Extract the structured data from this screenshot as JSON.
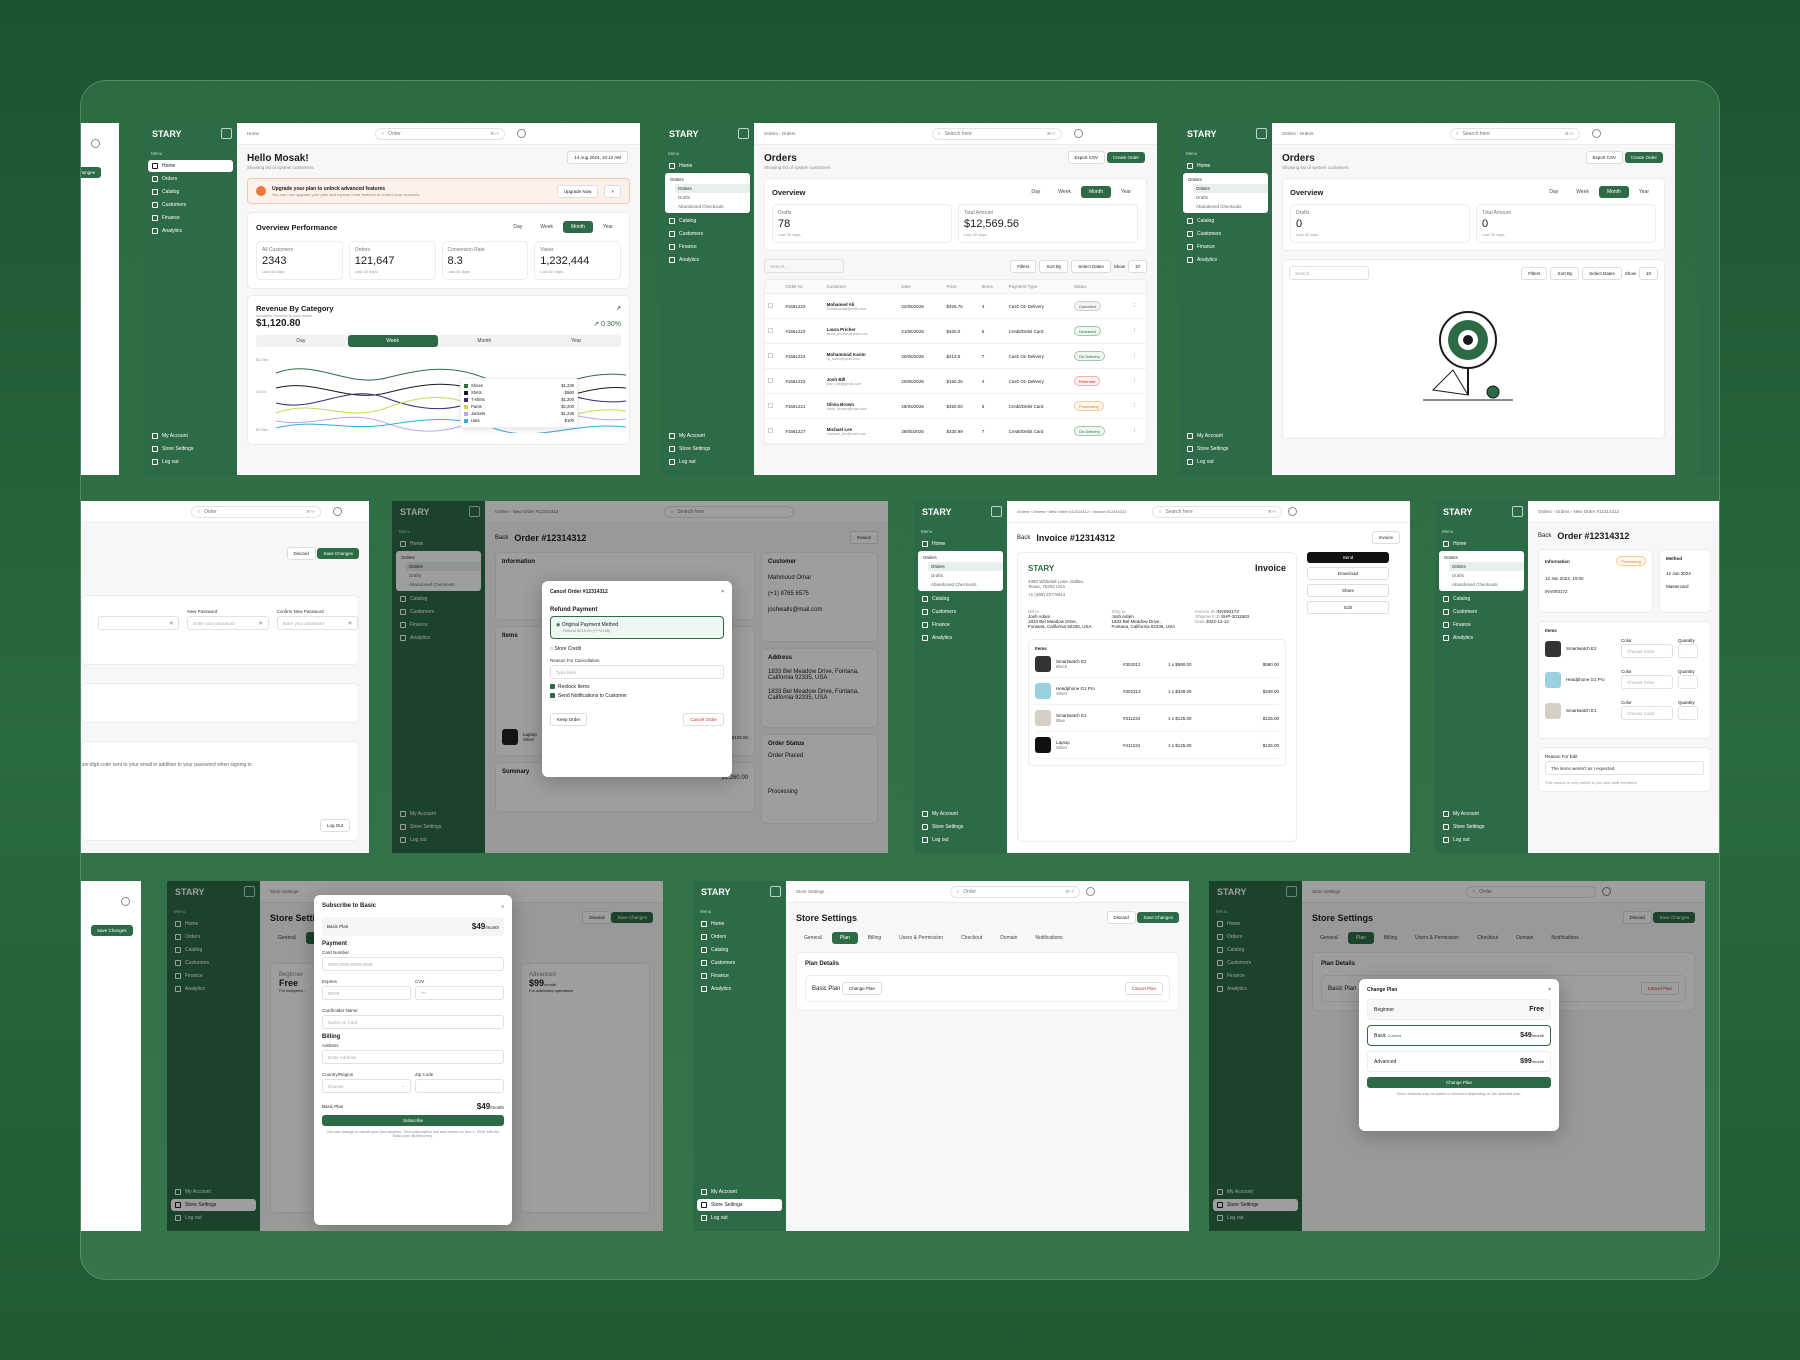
{
  "brand": "STARY",
  "menu_label": "Menu",
  "nav": {
    "home": "Home",
    "orders": "Orders",
    "catalog": "Catalog",
    "customers": "Customers",
    "finance": "Finance",
    "analytics": "Analytics",
    "my_account": "My Account",
    "store_settings": "Store Settings",
    "log_out": "Log out",
    "orders_sub": [
      "Orders",
      "Drafts",
      "Abandoned Checkouts"
    ]
  },
  "dashboard": {
    "breadcrumb": "Home",
    "search": "Order",
    "kbd": "⌘+F",
    "greeting": "Hello Mosak!",
    "subtitle": "Showing list of system customers",
    "date": "14 Aug 2024, 10:12 AM",
    "upgrade_title": "Upgrade your plan to unlock advanced features",
    "upgrade_desc": "You can now upgrade your plan and explore more features to control your accounts",
    "upgrade_btn": "Upgrade Now",
    "overview_title": "Overview Performance",
    "periods": [
      "Day",
      "Week",
      "Month",
      "Year"
    ],
    "stats": [
      {
        "label": "All Customers",
        "value": "2343",
        "sub": "Last 30 days"
      },
      {
        "label": "Orders",
        "value": "121,647",
        "sub": "Last 30 days"
      },
      {
        "label": "Conversion Rate",
        "value": "8.3",
        "sub": "Last 30 days"
      },
      {
        "label": "Views",
        "value": "1,232,444",
        "sub": "Last 30 days"
      }
    ],
    "revenue_title": "Revenue By Category",
    "revenue_sub": "Available revenue in your wallet",
    "revenue_value": "$1,120.80",
    "revenue_change": "↗ 0.30%",
    "y_ticks": [
      "$2.5bn",
      "40 bn",
      "$2.5bn"
    ],
    "legend": [
      {
        "name": "Shoes",
        "value": "$1,236",
        "color": "#2c6b45"
      },
      {
        "name": "Shirts",
        "value": "$560",
        "color": "#1a1a1a"
      },
      {
        "name": "T-shirts",
        "value": "$1,200",
        "color": "#3b2a7a"
      },
      {
        "name": "Pants",
        "value": "$2,200",
        "color": "#c8d84a"
      },
      {
        "name": "Jackets",
        "value": "$1,236",
        "color": "#b8a6e6"
      },
      {
        "name": "Hats",
        "value": "$100",
        "color": "#3aa9e0"
      }
    ]
  },
  "orders": {
    "breadcrumb": [
      "Orders",
      "Orders"
    ],
    "search": "Search here",
    "title": "Orders",
    "subtitle": "Showing list of system customers",
    "export": "Export CSV",
    "create": "Create Order",
    "overview": "Overview",
    "drafts_label": "Drafts",
    "drafts_value": "78",
    "total_label": "Total Amount",
    "total_value": "$12,569.56",
    "last": "Last 30 days",
    "search_small": "Search...",
    "filters": "Filters",
    "sort": "Sort By",
    "dates": "Select Dates",
    "show": "Show",
    "show_n": "10",
    "columns": [
      "Order ID",
      "Customer",
      "Date",
      "Price",
      "Items",
      "Payment Type",
      "Status"
    ],
    "rows": [
      {
        "id": "#1561223",
        "name": "Mohamed Ali",
        "email": "Mohamedali@mail.com",
        "date": "22/05/2026",
        "price": "$325.75",
        "items": "4",
        "pay": "Cash On Delivery",
        "status": "Canceled",
        "cls": "p-cancel"
      },
      {
        "id": "#1561223",
        "name": "Laura Pricher",
        "email": "laura_pricher@mail.com",
        "date": "21/05/2026",
        "price": "$460.0",
        "items": "5",
        "pay": "Credit/Debit Card",
        "status": "Delivered",
        "cls": "p-deliv"
      },
      {
        "id": "#1561223",
        "name": "Mohammad Karim",
        "email": "m_karim@mail.com",
        "date": "20/05/2026",
        "price": "$213.5",
        "items": "7",
        "pay": "Cash On Delivery",
        "status": "On Delivery",
        "cls": "p-deliv"
      },
      {
        "id": "#1561223",
        "name": "Josh Bill",
        "email": "josh_bill@gmail.com",
        "date": "20/05/2026",
        "price": "$150.25",
        "items": "4",
        "pay": "Cash On Delivery",
        "status": "Returned",
        "cls": "p-ret"
      },
      {
        "id": "#1561221",
        "name": "Olivia Brown",
        "email": "olivia_brown@mail.com",
        "date": "28/05/2026",
        "price": "$450.00",
        "items": "6",
        "pay": "Credit/Debit Card",
        "status": "Processing",
        "cls": "p-proc"
      },
      {
        "id": "#1561227",
        "name": "Michael Lee",
        "email": "michael_lee@mail.com",
        "date": "28/05/2026",
        "price": "$330.99",
        "items": "7",
        "pay": "Credit/Debit Card",
        "status": "On Delivery",
        "cls": "p-deliv"
      }
    ]
  },
  "orders_empty": {
    "drafts_value": "0",
    "total_value": "0"
  },
  "account": {
    "search": "Order",
    "discard": "Discard",
    "save": "Save Changes",
    "new_password": "New Password",
    "confirm_password": "Confirm New Password",
    "placeholder": "Enter your password",
    "twofa": "six-digit code sent to your email in addition to your password when signing in.",
    "logout": "Log Out"
  },
  "order_detail": {
    "breadcrumb": [
      "Orders",
      "New Order #12314312"
    ],
    "back": "Back",
    "title": "Order #12314312",
    "invoice": "Invoice",
    "info": "Information",
    "customer": "Customer",
    "customer_name": "Mahmoud Omar",
    "phone": "(+1) 8765 6575",
    "email": "joshwalls@mail.com",
    "address": "Address",
    "shipping": "1833 Bel Meadow Drive, Fontana, California 92335, USA",
    "billing": "1833 Bel Meadow Drive, Fontana, California 92335, USA",
    "items": "Items",
    "order_status": "Order Status",
    "placed": "Order Placed",
    "processing": "Processing",
    "summary": "Summary",
    "subtotal": "$1,260.00",
    "laptop": "Laptop",
    "silver": "Silver",
    "sku": "#411234",
    "qty": "1 x $125.00",
    "total": "$125.00",
    "modal_title": "Cancel Order #12314312",
    "refund": "Refund Payment",
    "orig": "Original Payment Method",
    "orig_sub": "Refund $216.00 (****2185)",
    "credit": "Store Credit",
    "reason": "Reason For Cancellation",
    "reason_ph": "Type here",
    "restock": "Restock Items",
    "notify": "Send Notifications to Customer",
    "keep": "Keep Order",
    "cancel": "Cancel Order"
  },
  "invoice": {
    "breadcrumb": [
      "Orders",
      "Orders",
      "New Order #12314312",
      "Invoice #12314312"
    ],
    "title": "Invoice #12314312",
    "back": "Back",
    "invoice_btn": "Invoice",
    "doc_title": "Invoice",
    "addr1": "4050 Whitetail Lane, Dallas,",
    "addr2": "Texas, 75202 USA",
    "addr3": "+1 (469) 227-9044",
    "bill_to": "Bill to",
    "ship_to": "Ship to",
    "name": "Josh Adam",
    "street": "1833 Bel Meadow Drive,",
    "city": "Fontana, California 92335, USA",
    "inv_id_l": "Invoice ID",
    "inv_id": "INV093172",
    "ship_id_l": "Shipment ID",
    "ship_id": "SHP-2011903",
    "date_l": "Date",
    "date": "2022-12-12",
    "items_title": "Items",
    "items": [
      {
        "name": "Smartwatch E2",
        "variant": "Black",
        "sku": "#302012",
        "price": "1 x $590.00",
        "total": "$590.00"
      },
      {
        "name": "Headphone G1 Pro",
        "variant": "Silver",
        "sku": "#302313",
        "price": "1 x $348.00",
        "total": "$348.00"
      },
      {
        "name": "Smartwatch E1",
        "variant": "Blue",
        "sku": "#311234",
        "price": "1 x $125.00",
        "total": "$125.00"
      },
      {
        "name": "Laptop",
        "variant": "Silver",
        "sku": "#411234",
        "price": "1 x $125.00",
        "total": "$125.00"
      }
    ],
    "send": "Send",
    "download": "Download",
    "share": "Share",
    "edit": "Edit"
  },
  "edit_order": {
    "title": "Order #12314312",
    "info": "Information",
    "method": "Method",
    "status": "Processing",
    "date": "12 Jan 2024, 10:00",
    "invoice_id": "INV093172",
    "ship_date": "12 Jan 2024",
    "method_val": "Mastercard",
    "items": "Items",
    "products": [
      "Smartwatch E2",
      "Headphone G1 Pro",
      "Smartwatch E1"
    ],
    "color_label": "Color",
    "color_ph": "Choose Color",
    "qty_label": "Quantity",
    "reason_label": "Reason For Edit",
    "reason_val": "The items weren't as I expected",
    "reason_note": "This reason is only visible to you and staff members"
  },
  "subscribe": {
    "title": "Subscribe to Basic",
    "plan": "Basic Plan",
    "price": "$49",
    "per": "/month",
    "payment": "Payment",
    "card": "Card Number",
    "card_ph": "0000-0000-0000-0000",
    "expires": "Expires",
    "exp_ph": "00/00",
    "cvv": "CVV",
    "cvv_ph": "***",
    "holder": "Cardholder Name",
    "holder_ph": "Name on Card",
    "billing": "Billing",
    "address": "Address",
    "address_ph": "Enter Address",
    "country": "Country/Region",
    "country_ph": "Choose",
    "zip": "Zip Code",
    "btn": "Subscribe",
    "note": "You can change or cancel your plan anytime. Your subscription will auto renew on Nov 1, 2025 with the Basic plan ($49/month).",
    "bg_beginner": "Beginner",
    "bg_free": "Free",
    "bg_adv": "Advanced",
    "bg_adv_price": "$99",
    "bg_adv_sub": "For advanced operations",
    "bg_beg_sub": "For independ..."
  },
  "store": {
    "breadcrumb": "Store Settings",
    "title": "Store Settings",
    "tabs": [
      "General",
      "Plan",
      "Billing",
      "Users & Permission",
      "Checkout",
      "Domain",
      "Notifications"
    ],
    "plan_details": "Plan Details",
    "basic_plan": "Basic Plan",
    "change_plan": "Change Plan",
    "cancel_plan": "Cancel Plan",
    "discard": "Discard",
    "save": "Save Changes"
  },
  "change_plan": {
    "title": "Change Plan",
    "options": [
      {
        "name": "Beginner",
        "badge": "",
        "price": "Free",
        "per": ""
      },
      {
        "name": "Basic",
        "badge": "Current",
        "price": "$49",
        "per": "/month"
      },
      {
        "name": "Advanced",
        "badge": "",
        "price": "$99",
        "per": "/month"
      }
    ],
    "btn": "Change Plan",
    "note": "Some features may be added or removed depending on the selected plan."
  }
}
